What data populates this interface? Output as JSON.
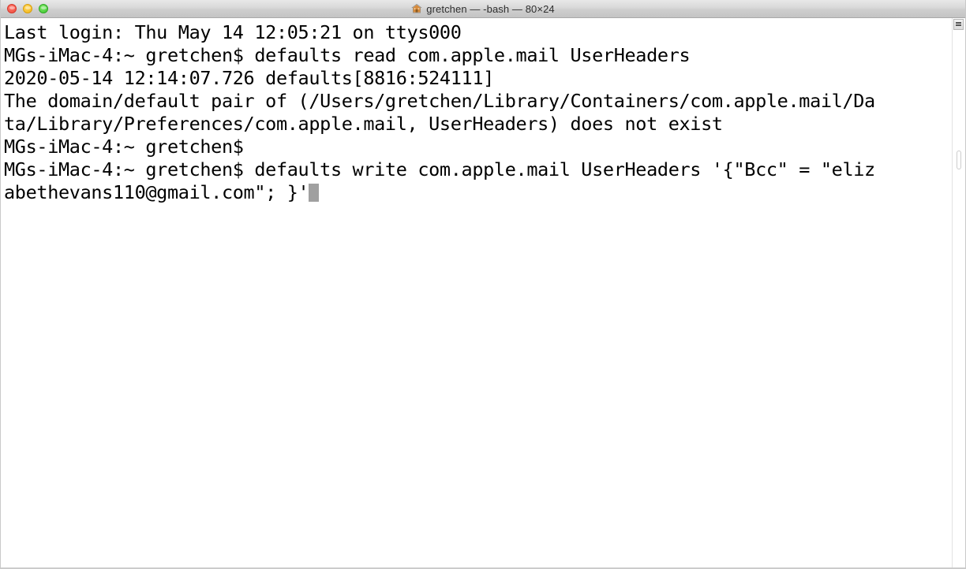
{
  "window": {
    "title": "gretchen — -bash — 80×24",
    "home_icon": "home-icon",
    "traffic_lights": {
      "close": "close-button",
      "minimize": "minimize-button",
      "maximize": "maximize-button"
    },
    "colors": {
      "titlebar_top": "#e8e8e8",
      "titlebar_bottom": "#c4c4c4",
      "background": "#ffffff",
      "text": "#000000",
      "cursor": "#a0a0a0",
      "close": "#ee4b3c",
      "minimize": "#f2b617",
      "maximize": "#3cc62e"
    }
  },
  "terminal": {
    "columns": 80,
    "rows": 24,
    "shell": "-bash",
    "user": "gretchen",
    "host": "MGs-iMac-4",
    "prompt": "MGs-iMac-4:~ gretchen$",
    "lines": [
      "Last login: Thu May 14 12:05:21 on ttys000",
      "MGs-iMac-4:~ gretchen$ defaults read com.apple.mail UserHeaders",
      "2020-05-14 12:14:07.726 defaults[8816:524111]",
      "The domain/default pair of (/Users/gretchen/Library/Containers/com.apple.mail/Da",
      "ta/Library/Preferences/com.apple.mail, UserHeaders) does not exist",
      "MGs-iMac-4:~ gretchen$",
      "MGs-iMac-4:~ gretchen$ defaults write com.apple.mail UserHeaders '{\"Bcc\" = \"eliz",
      "abethevans110@gmail.com\"; }'"
    ],
    "last_login": "Thu May 14 12:05:21 on ttys000",
    "timestamp": "2020-05-14 12:14:07.726",
    "process": "defaults[8816:524111]",
    "commands": [
      "defaults read com.apple.mail UserHeaders",
      "defaults write com.apple.mail UserHeaders '{\"Bcc\" = \"elizabethevans110@gmail.com\"; }'"
    ],
    "error_message": "The domain/default pair of (/Users/gretchen/Library/Containers/com.apple.mail/Data/Library/Preferences/com.apple.mail, UserHeaders) does not exist",
    "cursor_visible": true
  },
  "scrollbar": {
    "top_indicator": "scroll-lines-icon",
    "thumb": "scroll-thumb"
  }
}
